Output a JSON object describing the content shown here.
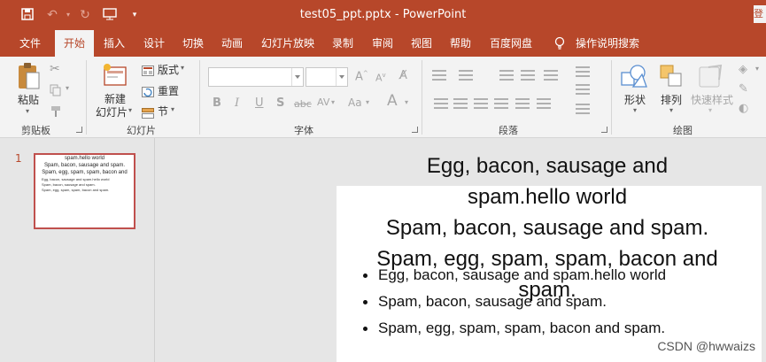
{
  "app": {
    "document_title": "test05_ppt.pptx",
    "app_name": "PowerPoint",
    "separator": " - ",
    "login_label": "登"
  },
  "tabs": [
    {
      "label": "文件"
    },
    {
      "label": "开始"
    },
    {
      "label": "插入"
    },
    {
      "label": "设计"
    },
    {
      "label": "切换"
    },
    {
      "label": "动画"
    },
    {
      "label": "幻灯片放映"
    },
    {
      "label": "录制"
    },
    {
      "label": "审阅"
    },
    {
      "label": "视图"
    },
    {
      "label": "帮助"
    },
    {
      "label": "百度网盘"
    }
  ],
  "active_tab": "开始",
  "tell_me": {
    "label": "操作说明搜索"
  },
  "ribbon": {
    "clipboard": {
      "group_label": "剪贴板",
      "paste_label": "粘贴"
    },
    "slides": {
      "group_label": "幻灯片",
      "new_slide_line1": "新建",
      "new_slide_line2": "幻灯片",
      "layout_label": "版式",
      "reset_label": "重置",
      "section_label": "节"
    },
    "font": {
      "group_label": "字体",
      "bold": "B",
      "italic": "I",
      "underline": "U",
      "shadow": "S",
      "strike": "abc",
      "spacing": "AV",
      "case": "Aa",
      "color": "A"
    },
    "paragraph": {
      "group_label": "段落"
    },
    "drawing": {
      "group_label": "绘图",
      "shape_label": "形状",
      "arrange_label": "排列",
      "quick_style_label": "快速样式"
    }
  },
  "thumbnail": {
    "slide_number": "1",
    "title_lines": [
      "spam.hello world",
      "Spam, bacon, sausage and spam.",
      "Spam, egg, spam, spam, bacon and"
    ],
    "bullets": [
      "Egg, bacon, sausage and spam.hello world",
      "Spam, bacon, sausage and spam.",
      "Spam, egg, spam, spam, bacon and spam."
    ]
  },
  "slide": {
    "title_lines": [
      "Egg, bacon, sausage and",
      "spam.hello world",
      "Spam, bacon, sausage and spam.",
      "Spam, egg, spam, spam, bacon and",
      "spam."
    ],
    "bullets": [
      "Egg, bacon, sausage and spam.hello world",
      "Spam, bacon, sausage and spam.",
      "Spam, egg, spam, spam, bacon and spam."
    ]
  },
  "watermark": "CSDN @hwwaizs",
  "colors": {
    "accent": "#b7472a",
    "ribbon_bg": "#f3f3f3",
    "workspace_bg": "#e6e6e6",
    "thumb_border": "#c0504d"
  }
}
